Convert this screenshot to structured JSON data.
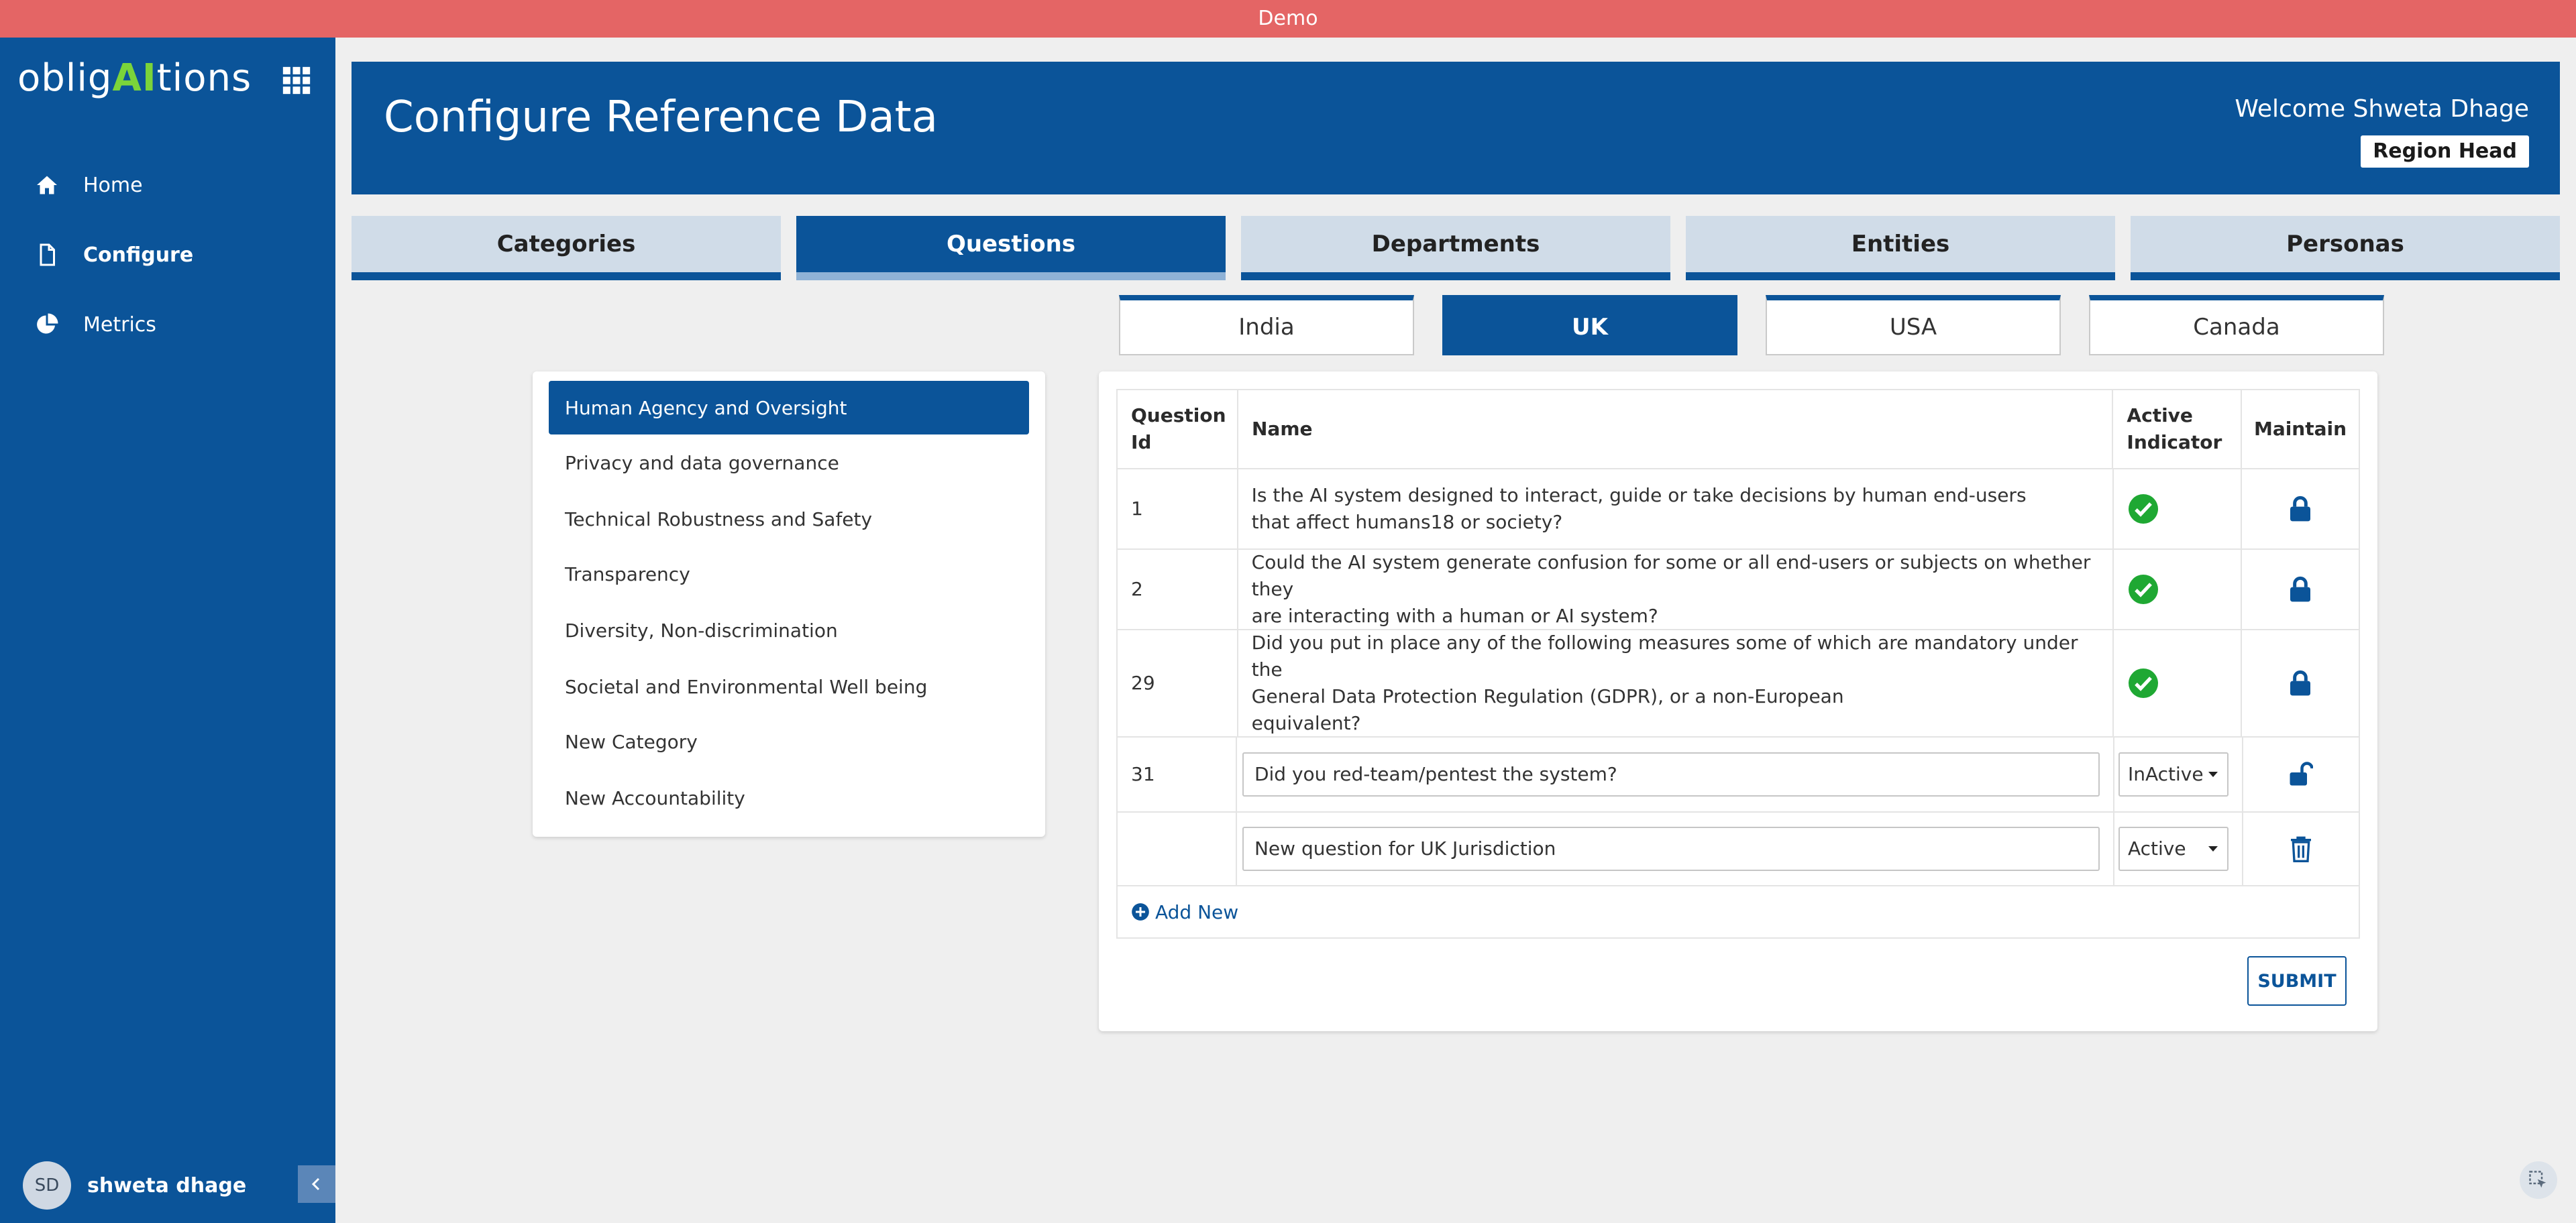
{
  "demo_label": "Demo",
  "sidebar": {
    "logo_pre": "oblig",
    "logo_ai": "AI",
    "logo_post": "tions",
    "nav": [
      {
        "label": "Home",
        "icon": "home-icon"
      },
      {
        "label": "Configure",
        "icon": "document-icon"
      },
      {
        "label": "Metrics",
        "icon": "pie-chart-icon"
      }
    ],
    "user": {
      "initials": "SD",
      "name": "shweta dhage"
    }
  },
  "header": {
    "title": "Configure Reference Data",
    "welcome": "Welcome Shweta Dhage",
    "role": "Region Head"
  },
  "main_tabs": [
    "Categories",
    "Questions",
    "Departments",
    "Entities",
    "Personas"
  ],
  "active_main_tab": "Questions",
  "jurisdiction_tabs": [
    "India",
    "UK",
    "USA",
    "Canada"
  ],
  "active_jurisdiction": "UK",
  "categories": [
    "Human Agency and Oversight",
    "Privacy and data governance",
    "Technical Robustness and Safety",
    "Transparency",
    "Diversity, Non-discrimination",
    "Societal and Environmental Well being",
    "New Category",
    "New Accountability"
  ],
  "active_category": "Human Agency and Oversight",
  "table": {
    "headers": {
      "id": "Question Id",
      "name": "Name",
      "active": "Active Indicator",
      "maintain": "Maintain"
    },
    "rows": [
      {
        "id": "1",
        "name_lines": [
          "Is the AI system designed to interact, guide or take decisions by human end-users",
          "that affect humans18 or society?"
        ],
        "status": "active",
        "maintain": "locked"
      },
      {
        "id": "2",
        "name_lines": [
          "Could the AI system generate confusion for some or all end-users or subjects on whether they",
          "are interacting with a human or AI system?"
        ],
        "status": "active",
        "maintain": "locked"
      },
      {
        "id": "29",
        "name_lines": [
          "Did you put in place any of the following measures some of which are mandatory under the",
          "General Data Protection Regulation (GDPR), or a non-European",
          "equivalent?"
        ],
        "status": "active",
        "maintain": "locked"
      }
    ],
    "edit_row": {
      "id": "31",
      "name_value": "Did you red-team/pentest the system?",
      "status_value": "InActive"
    },
    "new_row": {
      "id": "",
      "name_value": "New question for UK Jurisdiction",
      "status_value": "Active"
    },
    "add_new_label": "Add New"
  },
  "submit_label": "SUBMIT",
  "colors": {
    "primary": "#0b5499",
    "demo_bar": "#e46565",
    "check_green": "#1fa833",
    "logo_ai": "#7bd43a"
  }
}
